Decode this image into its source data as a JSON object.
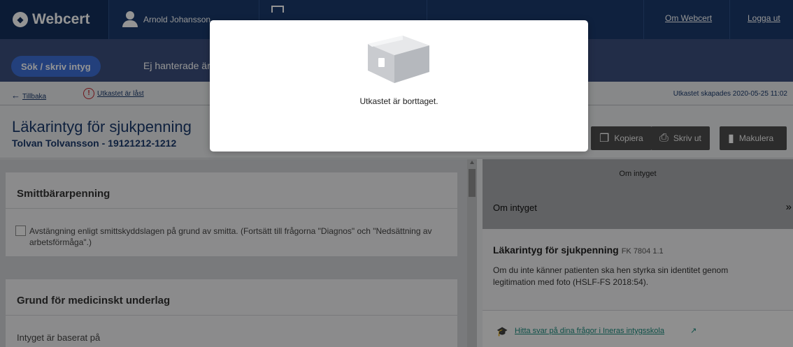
{
  "header": {
    "logo": "Webcert",
    "user": "Arnold Johansson",
    "links": [
      "Om Webcert",
      "Logga ut"
    ]
  },
  "nav": {
    "active": "Sök / skriv intyg",
    "item": "Ej hanterade ärenden"
  },
  "subbar": {
    "back": "Tillbaka",
    "locked": "Utkastet är låst",
    "created": "Utkastet skapades 2020-05-25 11:02"
  },
  "document": {
    "title": "Läkarintyg för sjukpenning",
    "patient": "Tolvan Tolvansson - 19121212-1212",
    "buttons": {
      "copy": "Kopiera",
      "print": "Skriv ut",
      "void": "Makulera"
    }
  },
  "sections": [
    {
      "title": "Smittbärarpenning",
      "checkbox_label": "Avstängning enligt smittskyddslagen på grund av smitta. (Fortsätt till frågorna \"Diagnos\" och \"Nedsättning av arbetsförmåga\".)"
    },
    {
      "title": "Grund för medicinskt underlag",
      "field_label": "Intyget är baserat på"
    }
  ],
  "sidepanel": {
    "tab": "Om intyget",
    "heading": "Om intyget",
    "chevron": "»",
    "cert_name": "Läkarintyg för sjukpenning",
    "cert_code": "FK 7804 1.1",
    "text": "Om du inte känner patienten ska hen styrka sin identitet genom legitimation med foto (HSLF-FS 2018:54).",
    "link": "Hitta svar på dina frågor i Ineras intygsskola"
  },
  "modal": {
    "message": "Utkastet är borttaget."
  },
  "colors": {
    "brand": "#1a3a6b",
    "accent": "#3d6fd6",
    "warning": "#c0262d",
    "link": "#1b8a7c"
  },
  "icons": [
    "webcert-logo-icon",
    "user-icon",
    "grid-icon",
    "arrow-left-icon",
    "warning-icon",
    "copy-icon",
    "print-icon",
    "trash-icon",
    "graduation-cap-icon",
    "external-link-icon",
    "empty-box-icon"
  ]
}
